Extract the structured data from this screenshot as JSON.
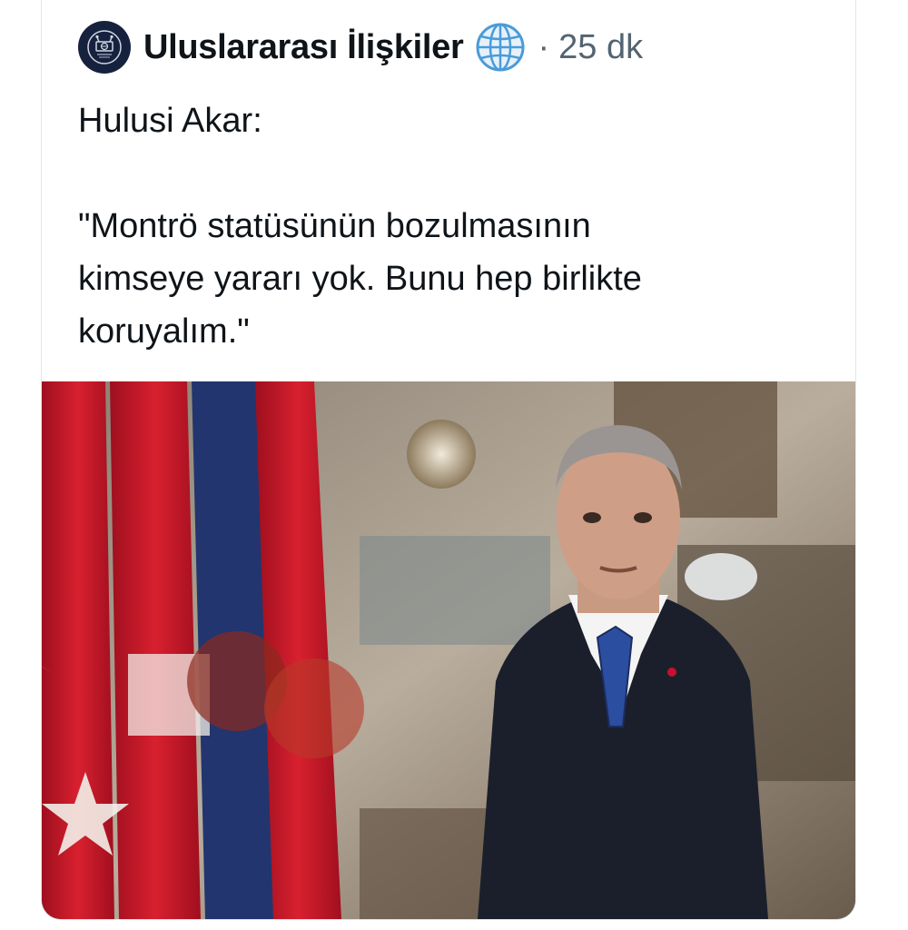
{
  "tweet": {
    "author": {
      "name": "Uluslararası İlişkiler",
      "avatar_icon": "globe-podium-logo-icon",
      "badge_icon": "globe-badge-icon"
    },
    "separator": "·",
    "timestamp": "25 dk",
    "text": {
      "line1": "Hulusi Akar:",
      "quote_line1": "\"Montrö statüsünün bozulmasının",
      "quote_line2": "kimseye yararı yok. Bunu hep birlikte",
      "quote_line3": "koruyalım.\""
    },
    "media": {
      "type": "photo",
      "icon": "photo"
    }
  },
  "colors": {
    "text": "#0f1419",
    "secondary_text": "#536471",
    "avatar_bg": "#16223d",
    "flag_red": "#c8102e",
    "flag_blue": "#1f3a7a"
  }
}
